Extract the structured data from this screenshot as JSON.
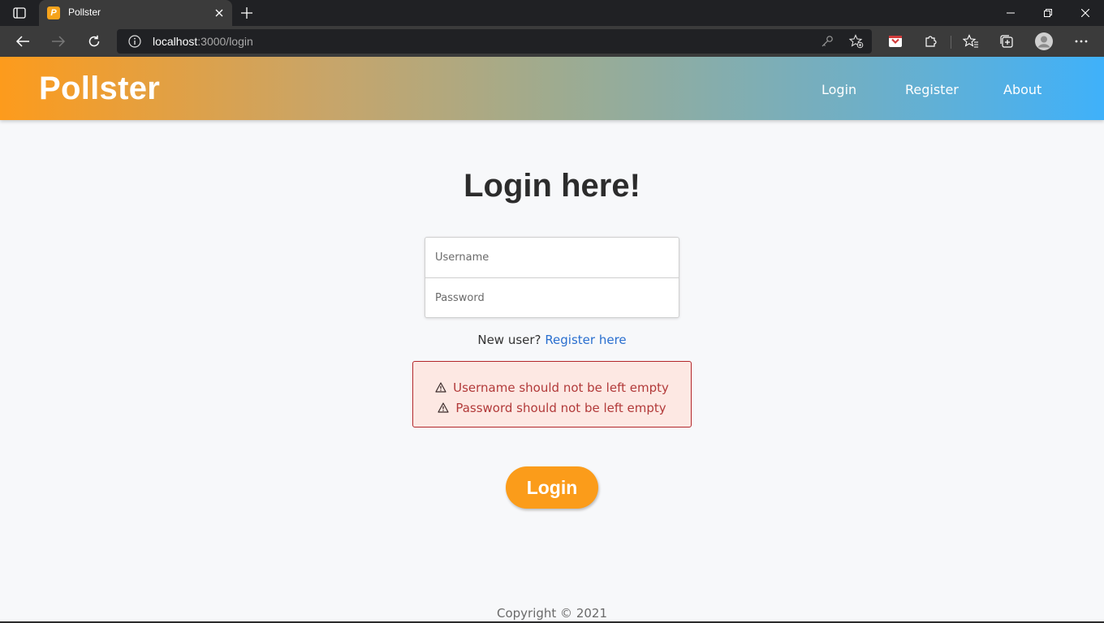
{
  "browser": {
    "tab_title": "Pollster",
    "url_host": "localhost",
    "url_rest": ":3000/login",
    "icons": {
      "tab_actions": "tab-actions-icon",
      "close_tab": "close-icon",
      "new_tab": "plus-icon",
      "back": "back-arrow-icon",
      "forward": "forward-arrow-icon",
      "refresh": "refresh-icon",
      "site_info": "info-icon",
      "key": "key-icon",
      "favorite_add": "star-add-icon",
      "extension_pocket": "pocket-icon",
      "extensions": "puzzle-icon",
      "favorites": "favorites-icon",
      "collections": "collections-icon",
      "profile": "profile-icon",
      "menu": "more-icon"
    }
  },
  "navbar": {
    "brand": "Pollster",
    "links": [
      "Login",
      "Register",
      "About"
    ]
  },
  "main": {
    "heading": "Login here!",
    "username_placeholder": "Username",
    "password_placeholder": "Password",
    "new_user_text": "New user?",
    "register_link": "Register here",
    "errors": [
      "Username should not be left empty",
      "Password should not be left empty"
    ],
    "login_button": "Login"
  },
  "footer": {
    "copyright": "Copyright © 2021"
  },
  "colors": {
    "brand_orange": "#fb9c1a",
    "brand_blue": "#3fb1fa",
    "error_text": "#b23a3a",
    "error_bg": "#fde8e3",
    "link": "#2a6fcf"
  }
}
